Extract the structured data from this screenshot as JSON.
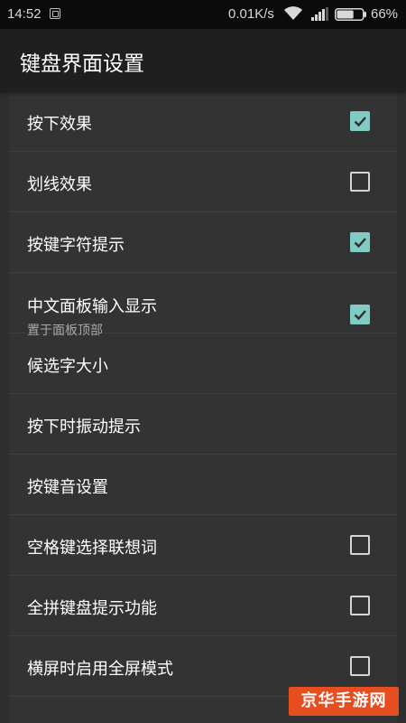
{
  "status_bar": {
    "time": "14:52",
    "network_speed": "0.01K/s",
    "battery_percent": "66%",
    "battery_level": 0.66
  },
  "app_bar": {
    "title": "键盘界面设置"
  },
  "settings": [
    {
      "label": "按下效果",
      "checkbox": true,
      "checked": true
    },
    {
      "label": "划线效果",
      "checkbox": true,
      "checked": false
    },
    {
      "label": "按键字符提示",
      "checkbox": true,
      "checked": true
    },
    {
      "label": "中文面板输入显示",
      "sublabel": "置于面板顶部",
      "checkbox": true,
      "checked": true
    },
    {
      "label": "候选字大小",
      "checkbox": false
    },
    {
      "label": "按下时振动提示",
      "checkbox": false
    },
    {
      "label": "按键音设置",
      "checkbox": false
    },
    {
      "label": "空格键选择联想词",
      "checkbox": true,
      "checked": false
    },
    {
      "label": "全拼键盘提示功能",
      "checkbox": true,
      "checked": false
    },
    {
      "label": "横屏时启用全屏模式",
      "checkbox": true,
      "checked": false
    }
  ],
  "watermark": "京华手游网",
  "colors": {
    "accent": "#80cbc4",
    "background": "#333333",
    "app_bar": "#1f1f1f",
    "watermark": "#e64d1f"
  }
}
